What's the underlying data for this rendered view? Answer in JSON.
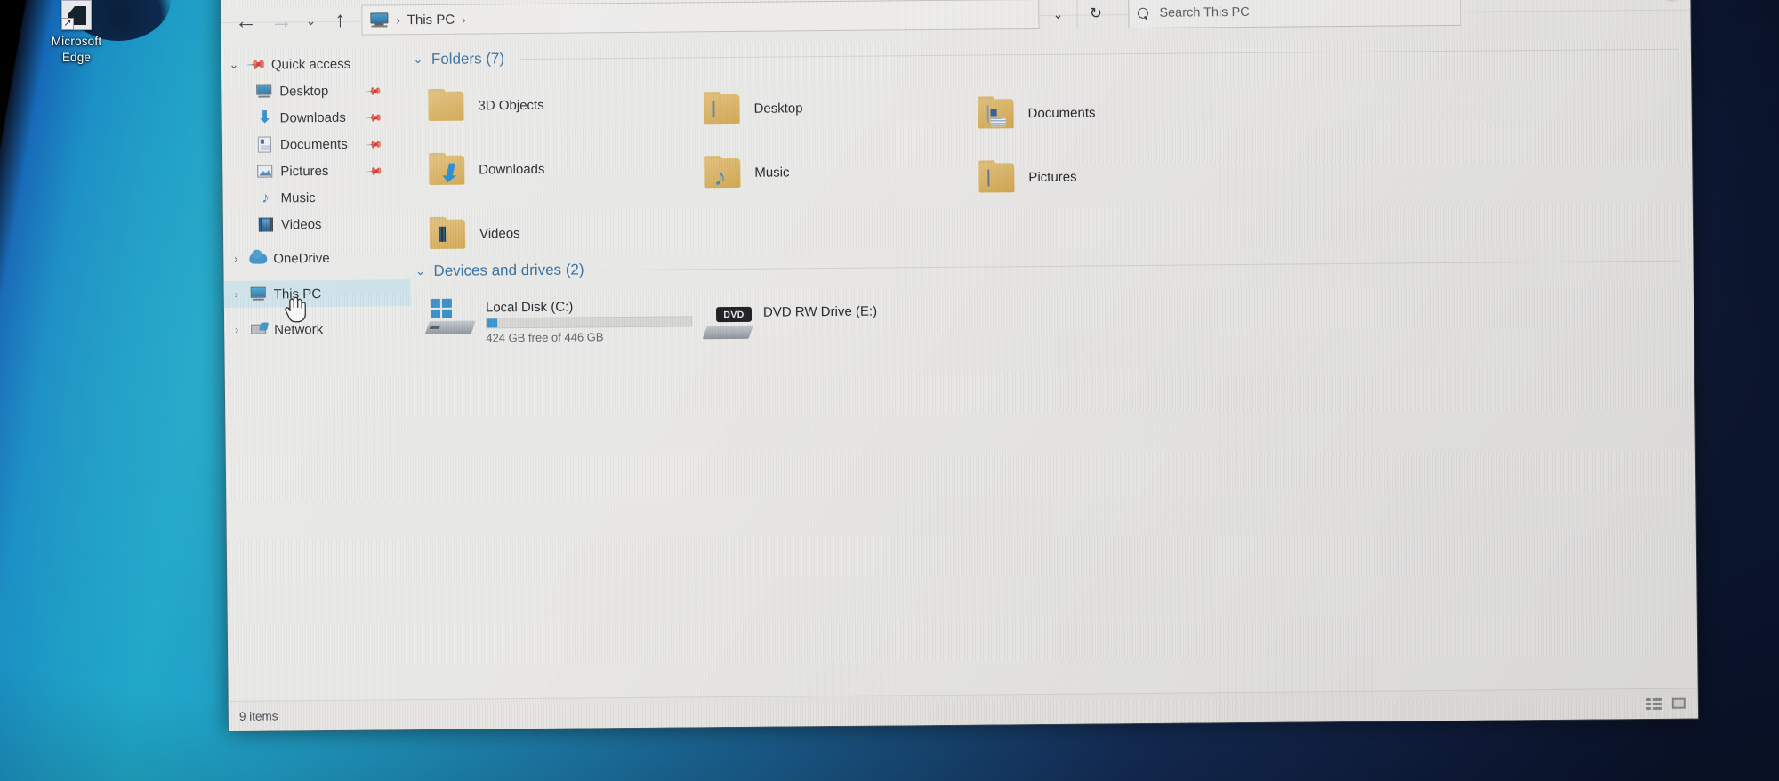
{
  "desktop": {
    "icons": [
      {
        "name": "Microsoft Edge",
        "label_line1": "Microsoft",
        "label_line2": "Edge"
      }
    ]
  },
  "window": {
    "title": "This PC",
    "ribbon_expand_icon": "chevron-down-icon",
    "help_label": "?"
  },
  "nav": {
    "back_icon": "←",
    "forward_icon": "→",
    "recent_dropdown_icon": "⌄",
    "up_icon": "↑",
    "address_dropdown_icon": "⌄",
    "refresh_icon": "↻",
    "breadcrumb": {
      "root_icon": "this-pc-icon",
      "sep1": "›",
      "item": "This PC",
      "sep2": "›"
    }
  },
  "search": {
    "placeholder": "Search This PC",
    "value": "",
    "icon": "search-icon"
  },
  "sidebar": {
    "groups": [
      {
        "label": "Quick access",
        "icon": "pin-star-icon",
        "expanded": true,
        "twisty": "⌄",
        "children": [
          {
            "label": "Desktop",
            "icon": "desktop-icon",
            "pinned": true,
            "pin_glyph": "📌"
          },
          {
            "label": "Downloads",
            "icon": "downloads-icon",
            "pinned": true,
            "pin_glyph": "📌"
          },
          {
            "label": "Documents",
            "icon": "documents-icon",
            "pinned": true,
            "pin_glyph": "📌"
          },
          {
            "label": "Pictures",
            "icon": "pictures-icon",
            "pinned": true,
            "pin_glyph": "📌"
          },
          {
            "label": "Music",
            "icon": "music-icon",
            "pinned": false,
            "pin_glyph": ""
          },
          {
            "label": "Videos",
            "icon": "videos-icon",
            "pinned": false,
            "pin_glyph": ""
          }
        ]
      },
      {
        "label": "OneDrive",
        "icon": "onedrive-icon",
        "expanded": false,
        "twisty": "›",
        "selected": false
      },
      {
        "label": "This PC",
        "icon": "this-pc-icon",
        "expanded": false,
        "twisty": "›",
        "selected": true
      },
      {
        "label": "Network",
        "icon": "network-icon",
        "expanded": false,
        "twisty": "›",
        "selected": false
      }
    ],
    "cursor": "hand-pointer"
  },
  "main": {
    "sections": [
      {
        "title": "Folders (7)",
        "twisty": "⌄",
        "items": [
          {
            "label": "3D Objects",
            "icon": "folder-3d-objects-icon"
          },
          {
            "label": "Desktop",
            "icon": "folder-desktop-icon"
          },
          {
            "label": "Documents",
            "icon": "folder-documents-icon"
          },
          {
            "label": "Downloads",
            "icon": "folder-downloads-icon"
          },
          {
            "label": "Music",
            "icon": "folder-music-icon"
          },
          {
            "label": "Pictures",
            "icon": "folder-pictures-icon"
          },
          {
            "label": "Videos",
            "icon": "folder-videos-icon"
          }
        ]
      },
      {
        "title": "Devices and drives (2)",
        "twisty": "⌄",
        "items": [
          {
            "label": "Local Disk (C:)",
            "icon": "hard-drive-icon",
            "free_text": "424 GB free of 446 GB",
            "free_gb": 424,
            "total_gb": 446,
            "used_percent": 5,
            "bar_color": "#2e95d8"
          },
          {
            "label": "DVD RW Drive (E:)",
            "icon": "dvd-drive-icon",
            "badge": "DVD",
            "free_text": "",
            "used_percent": 0
          }
        ]
      }
    ]
  },
  "status": {
    "items_text": "9 items",
    "view_details_icon": "details-view-icon",
    "view_large_icon": "large-icons-view-icon"
  },
  "colors": {
    "selection": "#cfe8ef",
    "accent_blue": "#2e95d8",
    "section_header": "#2a6ea8",
    "window_bg": "#efeeec",
    "desktop_teal": "#21a8c9"
  }
}
